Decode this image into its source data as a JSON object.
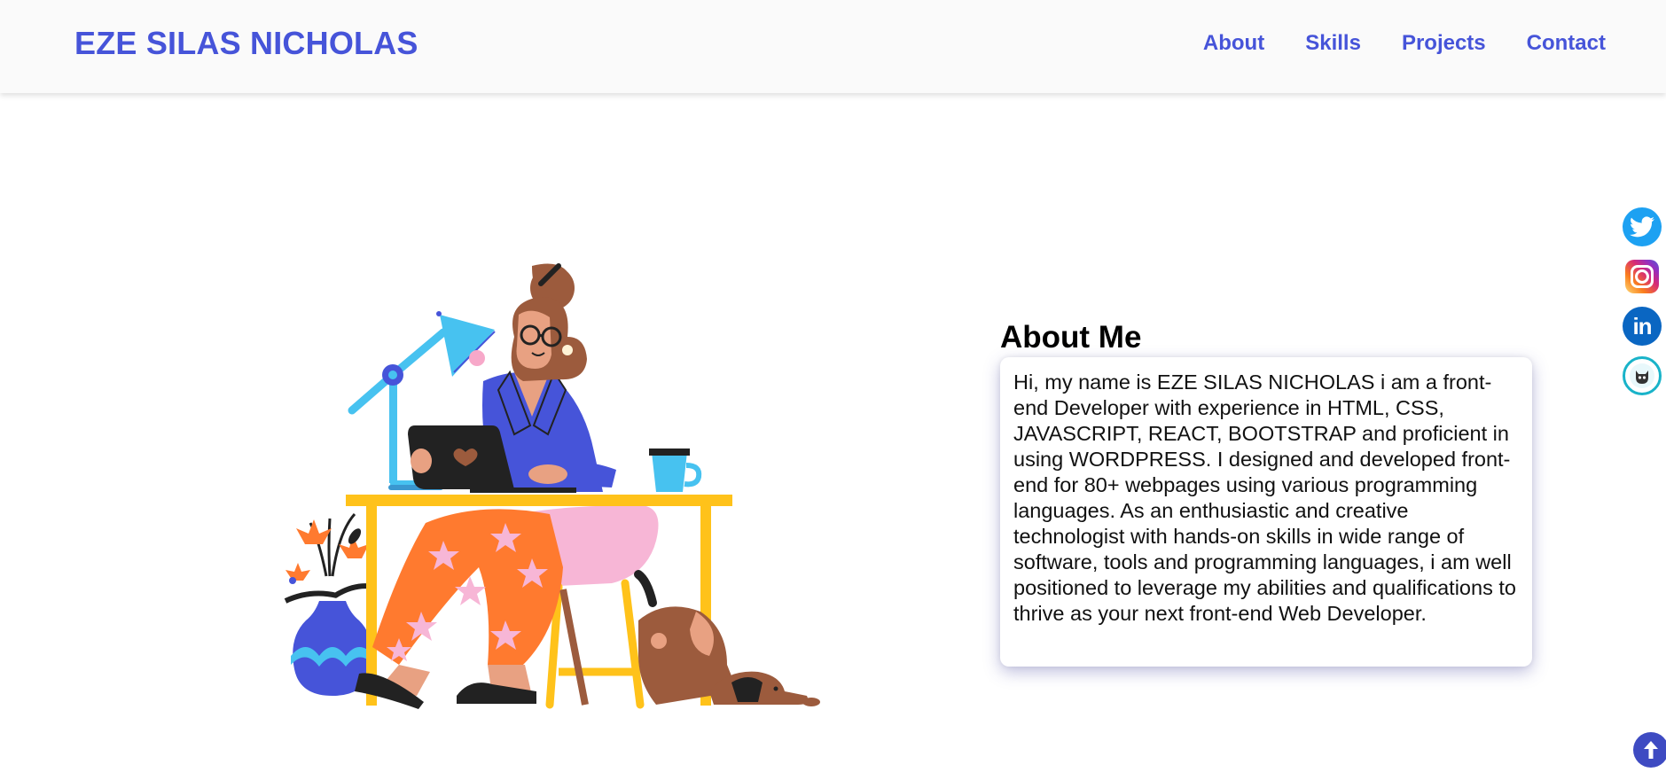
{
  "header": {
    "brand": "EZE SILAS NICHOLAS",
    "nav": [
      "About",
      "Skills",
      "Projects",
      "Contact"
    ]
  },
  "about": {
    "title": "About Me",
    "text": "Hi, my name is EZE SILAS NICHOLAS i am a front-end Developer with experience in HTML, CSS, JAVASCRIPT, REACT, BOOTSTRAP and proficient in using WORDPRESS. I designed and developed front-end for 80+ webpages using various programming languages. As an enthusiastic and creative technologist with hands-on skills in wide range of software, tools and programming languages, i am well positioned to leverage my abilities and qualifications to thrive as your next front-end Web Developer."
  },
  "social": [
    "twitter-icon",
    "instagram-icon",
    "linkedin-icon",
    "github-icon"
  ],
  "colors": {
    "brand": "#4654d9",
    "twitter": "#1da1f2",
    "linkedin": "#0a66c2",
    "scroll_top": "#3e4bc2"
  }
}
